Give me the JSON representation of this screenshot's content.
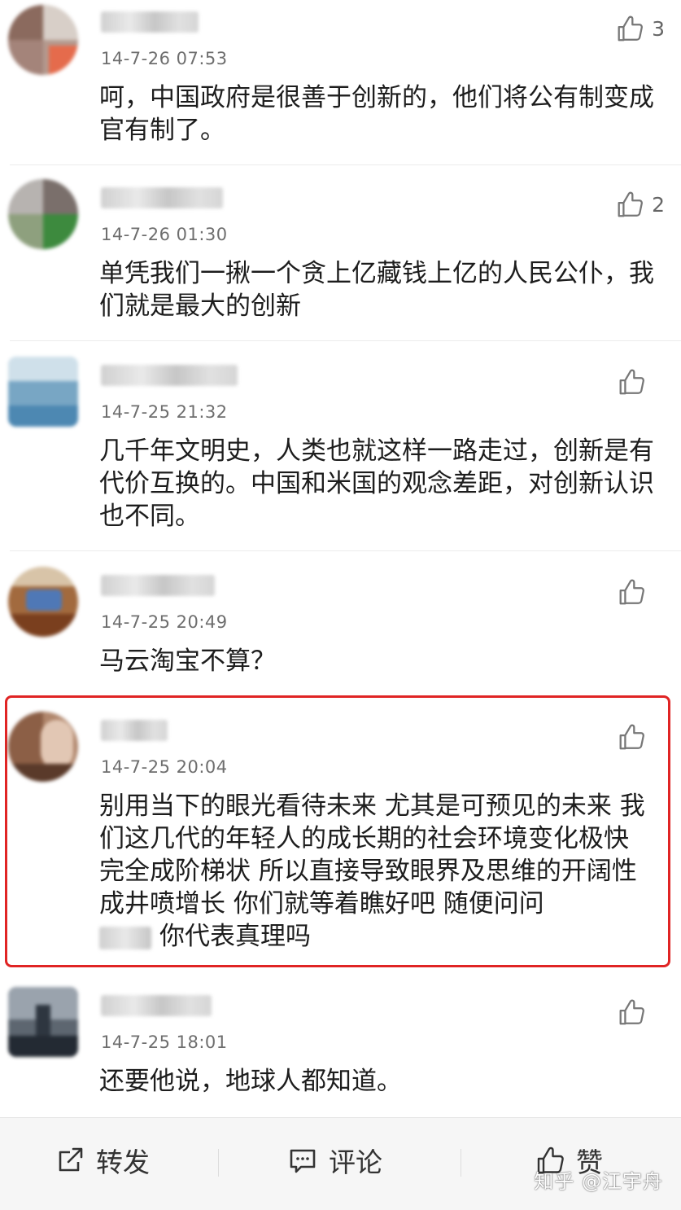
{
  "comments": [
    {
      "time": "14-7-26 07:53",
      "text": "呵，中国政府是很善于创新的，他们将公有制变成官有制了。",
      "likes": "3"
    },
    {
      "time": "14-7-26 01:30",
      "text": "单凭我们一揪一个贪上亿藏钱上亿的人民公仆，我们就是最大的创新",
      "likes": "2"
    },
    {
      "time": "14-7-25 21:32",
      "text": "几千年文明史，人类也就这样一路走过，创新是有代价互换的。中国和米国的观念差距，对创新认识也不同。",
      "likes": ""
    },
    {
      "time": "14-7-25 20:49",
      "text": "马云淘宝不算？",
      "likes": ""
    },
    {
      "time": "14-7-25 20:04",
      "text": "别用当下的眼光看待未来 尤其是可预见的未来 我们这几代的年轻人的成长期的社会环境变化极快 完全成阶梯状 所以直接导致眼界及思维的开阔性成井喷增长 你们就等着瞧好吧 随便问问",
      "text_tail": "你代表真理吗",
      "likes": "",
      "highlighted": true
    },
    {
      "time": "14-7-25 18:01",
      "text": "还要他说，地球人都知道。",
      "likes": ""
    }
  ],
  "footer": {
    "repost_label": "转发",
    "comment_label": "评论",
    "like_label": "赞",
    "repost_icon": "share-icon",
    "comment_icon": "comment-icon",
    "like_icon": "thumbs-up-icon"
  },
  "watermark": "知乎 @江宇舟",
  "colors": {
    "highlight_border": "#e02424",
    "time_text": "#6e6e6e",
    "footer_bg": "#f6f6f6"
  }
}
